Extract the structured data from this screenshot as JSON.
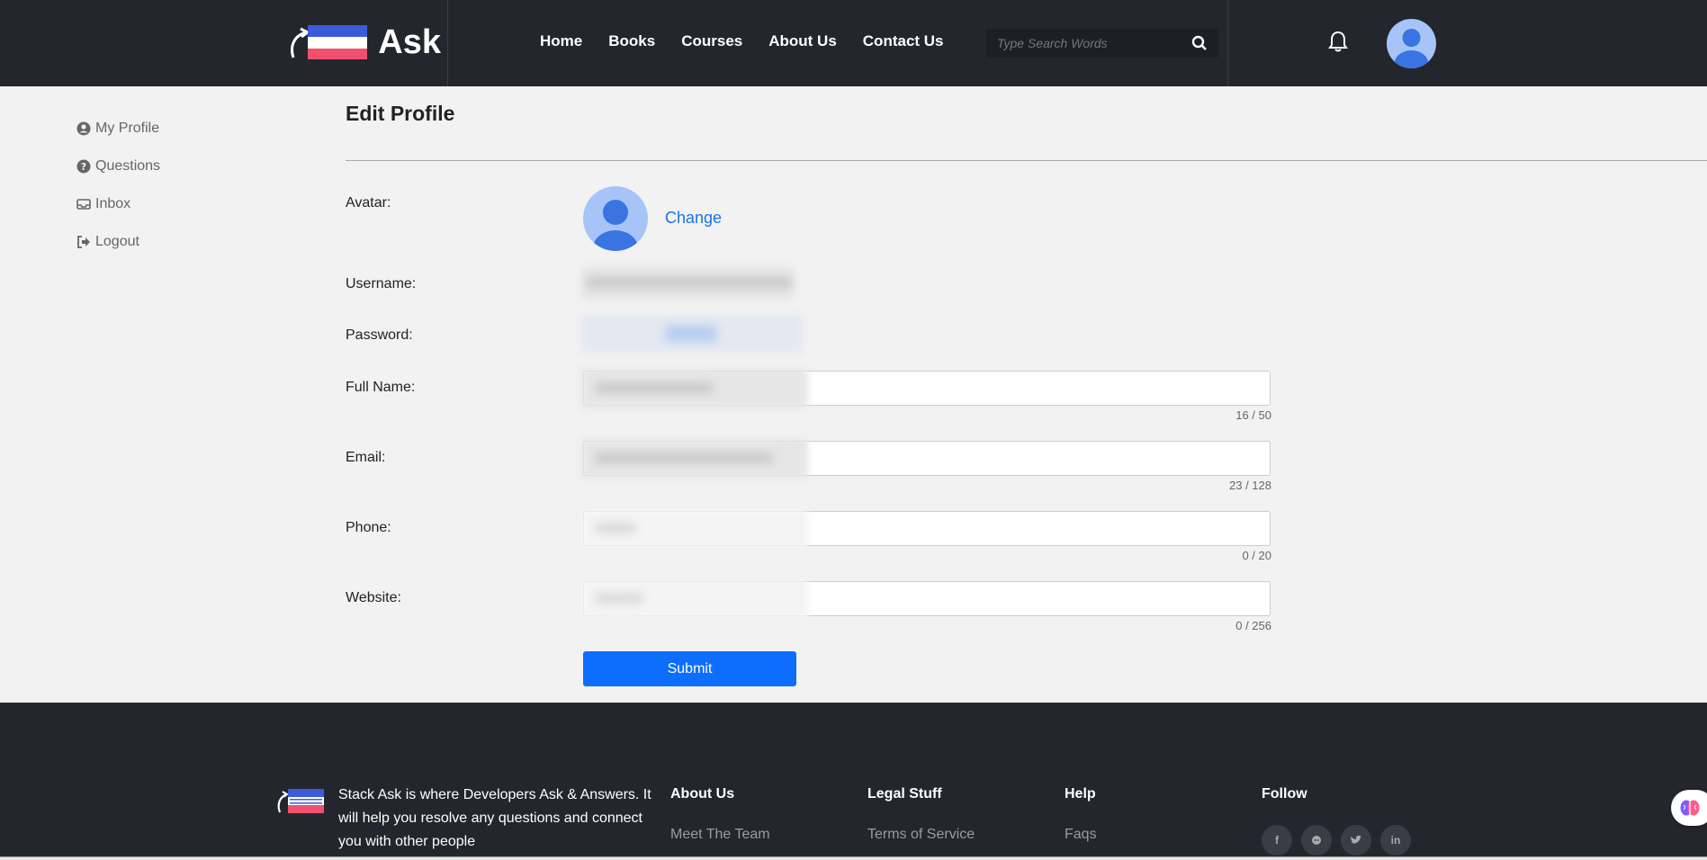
{
  "header": {
    "logo_text": "Ask",
    "nav": [
      "Home",
      "Books",
      "Courses",
      "About Us",
      "Contact Us"
    ],
    "search_placeholder": "Type Search Words"
  },
  "sidebar": {
    "items": [
      {
        "label": "My Profile",
        "icon": "user-circle-icon"
      },
      {
        "label": "Questions",
        "icon": "question-circle-icon"
      },
      {
        "label": "Inbox",
        "icon": "inbox-icon"
      },
      {
        "label": "Logout",
        "icon": "logout-icon"
      }
    ]
  },
  "form": {
    "title": "Edit Profile",
    "avatar_label": "Avatar:",
    "change_label": "Change",
    "username_label": "Username:",
    "password_label": "Password:",
    "fullname_label": "Full Name:",
    "fullname_counter": "16 / 50",
    "email_label": "Email:",
    "email_counter": "23 / 128",
    "phone_label": "Phone:",
    "phone_counter": "0 / 20",
    "website_label": "Website:",
    "website_counter": "0 / 256",
    "submit_label": "Submit"
  },
  "footer": {
    "description": "Stack Ask is where Developers Ask & Answers. It will help you resolve any questions and connect you with other people",
    "about_head": "About Us",
    "about_link": "Meet The Team",
    "legal_head": "Legal Stuff",
    "legal_link": "Terms of Service",
    "help_head": "Help",
    "help_link": "Faqs",
    "follow_head": "Follow",
    "social": [
      "f",
      "gh",
      "tw",
      "in"
    ]
  },
  "colors": {
    "header_bg": "#24262d",
    "accent": "#0d6efd",
    "link": "#1a73e8",
    "page_bg": "#f2f2f2"
  }
}
